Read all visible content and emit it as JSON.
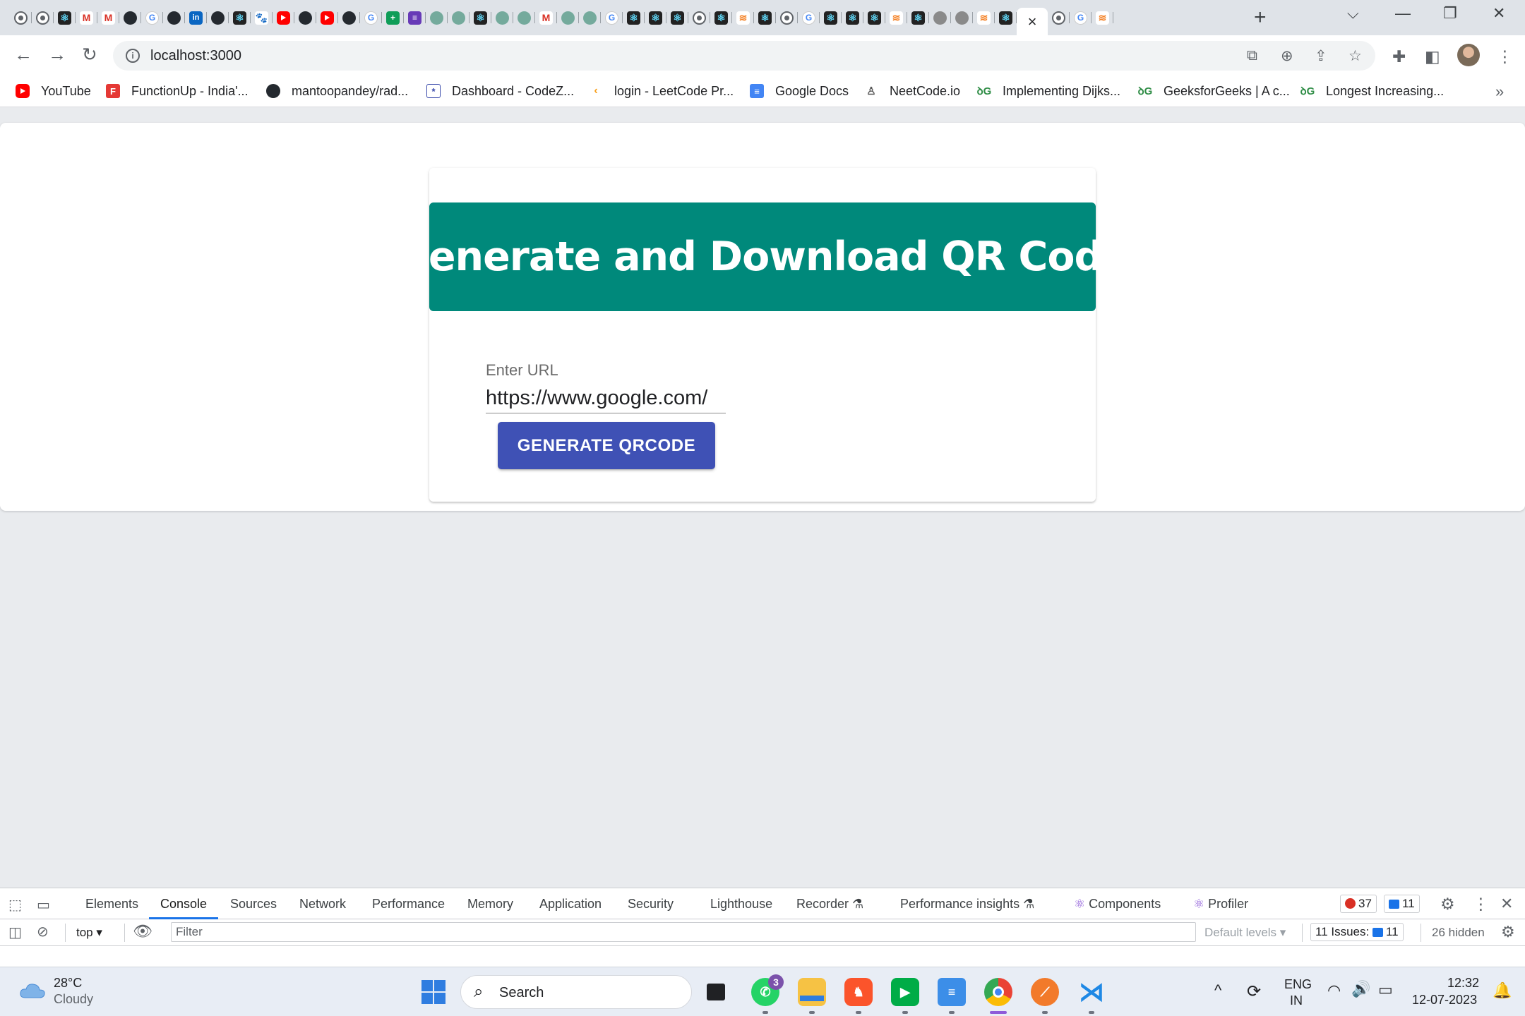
{
  "browser": {
    "tab_icons": [
      "chrome",
      "chrome",
      "react",
      "gmail",
      "gmail",
      "github",
      "google",
      "github",
      "linkedin",
      "github",
      "react",
      "pawprint",
      "youtube",
      "github",
      "youtube",
      "github",
      "google",
      "sheets",
      "forms",
      "openai",
      "openai",
      "react",
      "openai",
      "openai",
      "gmail",
      "openai",
      "openai",
      "google",
      "react",
      "react",
      "react",
      "chrome",
      "react",
      "stackoverflow",
      "react",
      "chrome",
      "google",
      "react",
      "react",
      "react",
      "stackoverflow",
      "react",
      "globe",
      "globe",
      "stackoverflow",
      "react"
    ],
    "tab_icons_after": [
      "chrome",
      "google",
      "stackoverflow"
    ],
    "active_tab_close": "×",
    "new_tab": "+",
    "url": "localhost:3000",
    "window_controls": [
      "chevron-down",
      "minimize",
      "restore",
      "close"
    ]
  },
  "bookmarks": [
    {
      "label": "YouTube",
      "icon": "youtube"
    },
    {
      "label": "FunctionUp - India'...",
      "icon": "functionup"
    },
    {
      "label": "mantoopandey/rad...",
      "icon": "github"
    },
    {
      "label": "Dashboard - CodeZ...",
      "icon": "codezinger"
    },
    {
      "label": "login - LeetCode Pr...",
      "icon": "leetcode"
    },
    {
      "label": "Google Docs",
      "icon": "google-docs"
    },
    {
      "label": "NeetCode.io",
      "icon": "neetcode"
    },
    {
      "label": "Implementing Dijks...",
      "icon": "geeksforgeeks"
    },
    {
      "label": "GeeksforGeeks | A c...",
      "icon": "geeksforgeeks"
    },
    {
      "label": "Longest Increasing...",
      "icon": "geeksforgeeks"
    }
  ],
  "bookmarks_more": "»",
  "page": {
    "title": "Generate and Download QR Code",
    "url_label": "Enter URL",
    "url_value": "https://www.google.com/",
    "button": "GENERATE QRCODE",
    "colors": {
      "header": "#00897b",
      "button": "#3f51b5"
    }
  },
  "devtools": {
    "tabs": [
      "Elements",
      "Console",
      "Sources",
      "Network",
      "Performance",
      "Memory",
      "Application",
      "Security",
      "Lighthouse",
      "Recorder",
      "Performance insights",
      "Components",
      "Profiler"
    ],
    "active_tab": "Console",
    "errors": "37",
    "messages": "11",
    "context": "top",
    "filter_placeholder": "Filter",
    "levels": "Default levels",
    "issues_label": "11 Issues:",
    "issues_count": "11",
    "hidden": "26 hidden",
    "colors": {
      "accent": "#1a73e8",
      "error": "#d93025"
    }
  },
  "taskbar": {
    "temperature": "28°C",
    "condition": "Cloudy",
    "search": "Search",
    "whatsapp_badge": "3",
    "lang_top": "ENG",
    "lang_bottom": "IN",
    "time": "12:32",
    "date": "12-07-2023"
  }
}
